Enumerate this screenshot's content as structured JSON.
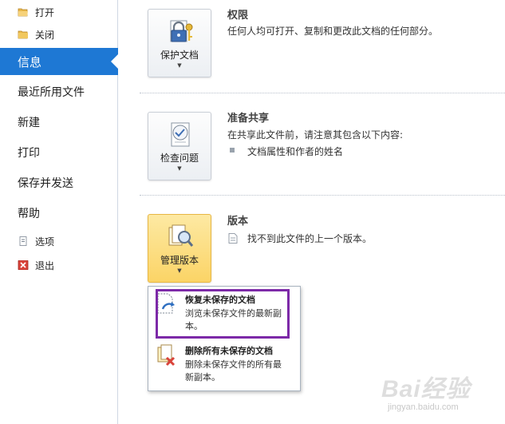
{
  "sidebar": {
    "open_label": "打开",
    "close_label": "关闭",
    "info_label": "信息",
    "recent_label": "最近所用文件",
    "new_label": "新建",
    "print_label": "打印",
    "save_send_label": "保存并发送",
    "help_label": "帮助",
    "options_label": "选项",
    "exit_label": "退出"
  },
  "permissions": {
    "button_label": "保护文档",
    "title": "权限",
    "description": "任何人均可打开、复制和更改此文档的任何部分。"
  },
  "prepare": {
    "button_label": "检查问题",
    "title": "准备共享",
    "description": "在共享此文件前，请注意其包含以下内容:",
    "bullet": "文档属性和作者的姓名"
  },
  "versions": {
    "button_label": "管理版本",
    "title": "版本",
    "description": "找不到此文件的上一个版本。"
  },
  "dropdown": {
    "recover_title": "恢复未保存的文档",
    "recover_desc": "浏览未保存文件的最新副本。",
    "delete_title": "删除所有未保存的文档",
    "delete_desc": "删除未保存文件的所有最新副本。"
  },
  "watermark": {
    "brand": "Bai经验",
    "url": "jingyan.baidu.com"
  },
  "colors": {
    "active_tab": "#1e78d4",
    "highlight_button": "#fbd466",
    "selection_border": "#7d2aa8"
  }
}
